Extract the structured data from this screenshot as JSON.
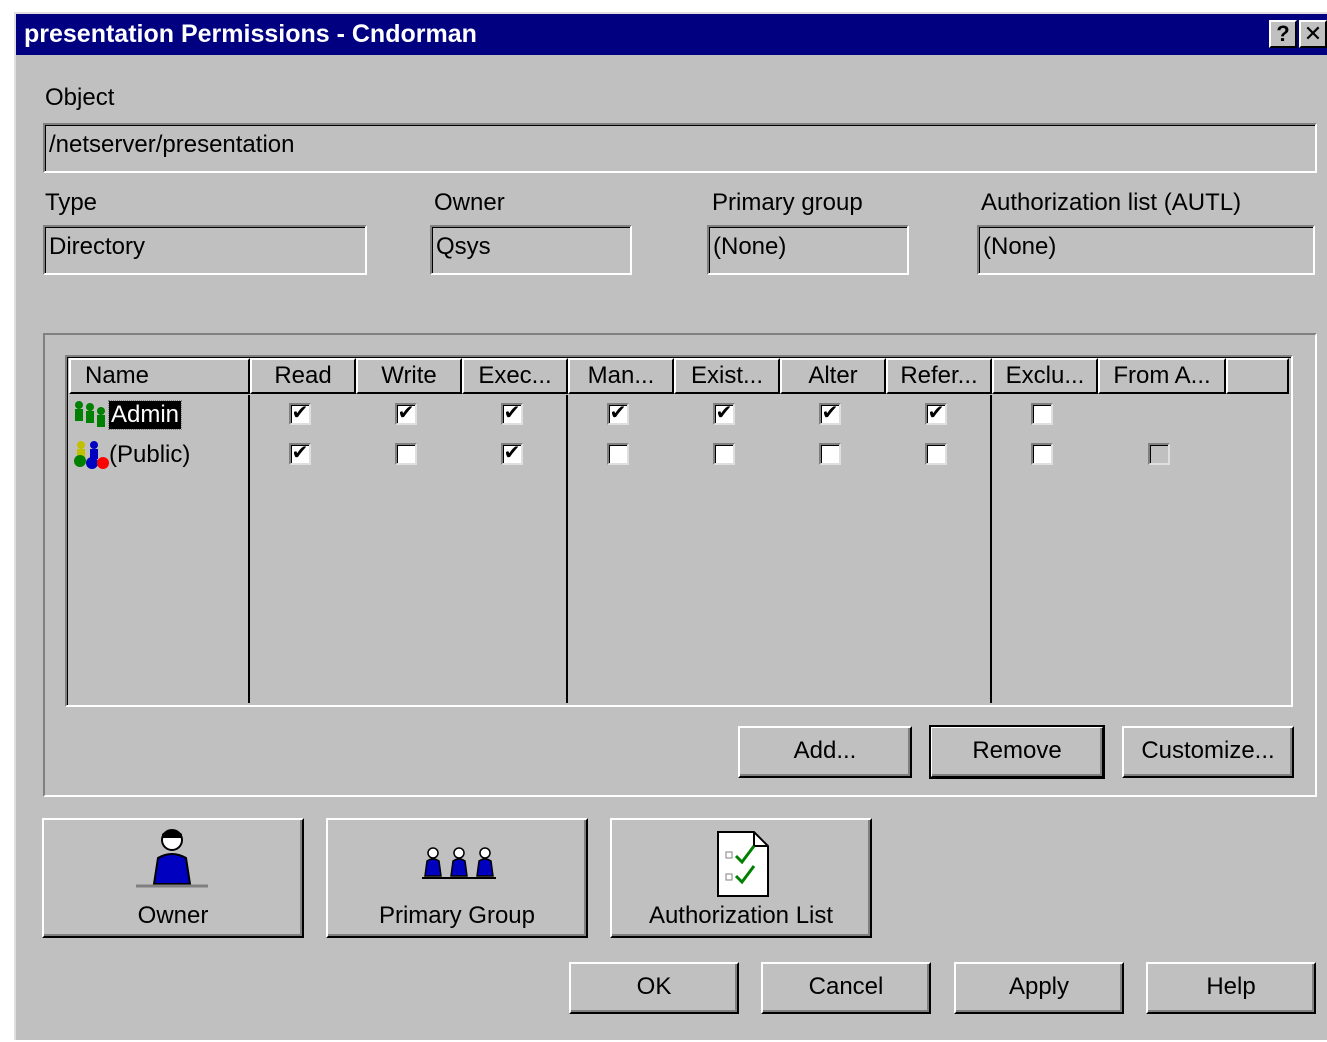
{
  "window": {
    "title": "presentation Permissions - Cndorman",
    "help_btn": "?",
    "close_btn": "✕"
  },
  "object": {
    "label": "Object",
    "value": "/netserver/presentation"
  },
  "type": {
    "label": "Type",
    "value": "Directory"
  },
  "owner": {
    "label": "Owner",
    "value": "Qsys"
  },
  "primary_group": {
    "label": "Primary group",
    "value": "(None)"
  },
  "autl": {
    "label": "Authorization list (AUTL)",
    "value": "(None)"
  },
  "table": {
    "columns": [
      "Name",
      "Read",
      "Write",
      "Exec...",
      "Man...",
      "Exist...",
      "Alter",
      "Refer...",
      "Exclu...",
      "From A..."
    ],
    "rows": [
      {
        "name": "Admin",
        "icon": "users-group-icon",
        "read": true,
        "write": true,
        "exec": true,
        "man": true,
        "exist": true,
        "alter": true,
        "refer": true,
        "exclu": false,
        "from_a": null
      },
      {
        "name": "(Public)",
        "icon": "public-group-icon",
        "read": true,
        "write": false,
        "exec": true,
        "man": false,
        "exist": false,
        "alter": false,
        "refer": false,
        "exclu": false,
        "from_a": false
      }
    ]
  },
  "list_buttons": {
    "add": "Add...",
    "remove": "Remove",
    "customize": "Customize..."
  },
  "big_buttons": {
    "owner": "Owner",
    "primary_group": "Primary Group",
    "authorization_list": "Authorization List"
  },
  "footer": {
    "ok": "OK",
    "cancel": "Cancel",
    "apply": "Apply",
    "help": "Help"
  },
  "colors": {
    "titlebar": "#000080",
    "face": "#c0c0c0",
    "icon_blue": "#0000c0"
  },
  "check_glyph": "✔"
}
